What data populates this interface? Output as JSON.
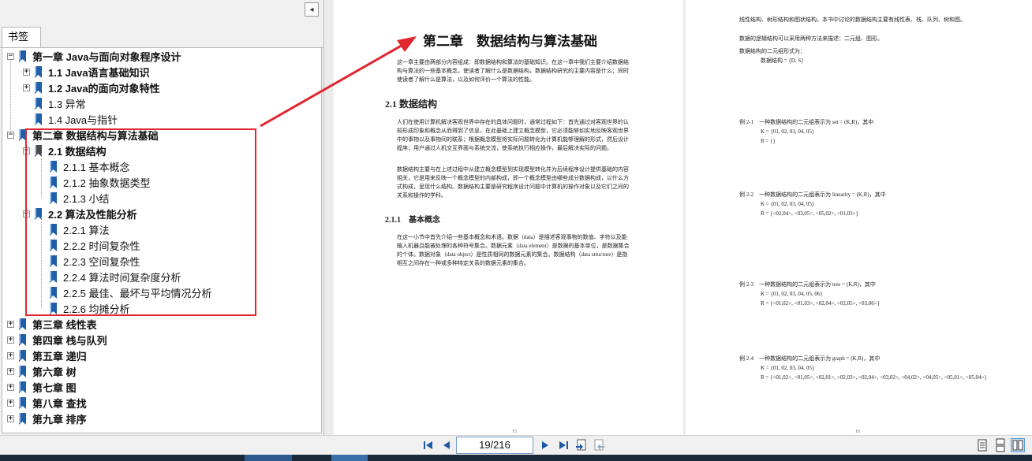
{
  "sidebar": {
    "tab_label": "书签",
    "collapse_glyph": "◂",
    "items": [
      {
        "label": "第一章 Java与面向对象程序设计",
        "level": 0,
        "bold": true,
        "expander": "−"
      },
      {
        "label": "1.1 Java语言基础知识",
        "level": 1,
        "bold": true,
        "expander": "+"
      },
      {
        "label": "1.2 Java的面向对象特性",
        "level": 1,
        "bold": true,
        "expander": "+"
      },
      {
        "label": "1.3 异常",
        "level": 1,
        "bold": false,
        "expander": ""
      },
      {
        "label": "1.4 Java与指针",
        "level": 1,
        "bold": false,
        "expander": ""
      },
      {
        "label": "第二章 数据结构与算法基础",
        "level": 0,
        "bold": true,
        "expander": "−"
      },
      {
        "label": "2.1 数据结构",
        "level": 1,
        "bold": true,
        "expander": "−"
      },
      {
        "label": "2.1.1 基本概念",
        "level": 2,
        "bold": false,
        "expander": ""
      },
      {
        "label": "2.1.2 抽象数据类型",
        "level": 2,
        "bold": false,
        "expander": ""
      },
      {
        "label": "2.1.3 小结",
        "level": 2,
        "bold": false,
        "expander": ""
      },
      {
        "label": "2.2 算法及性能分析",
        "level": 1,
        "bold": true,
        "expander": "−"
      },
      {
        "label": "2.2.1 算法",
        "level": 2,
        "bold": false,
        "expander": ""
      },
      {
        "label": "2.2.2 时间复杂性",
        "level": 2,
        "bold": false,
        "expander": ""
      },
      {
        "label": "2.2.3 空间复杂性",
        "level": 2,
        "bold": false,
        "expander": ""
      },
      {
        "label": "2.2.4 算法时间复杂度分析",
        "level": 2,
        "bold": false,
        "expander": ""
      },
      {
        "label": "2.2.5 最佳、最坏与平均情况分析",
        "level": 2,
        "bold": false,
        "expander": ""
      },
      {
        "label": "2.2.6 均摊分析",
        "level": 2,
        "bold": false,
        "expander": ""
      },
      {
        "label": "第三章 线性表",
        "level": 0,
        "bold": true,
        "expander": "+"
      },
      {
        "label": "第四章 栈与队列",
        "level": 0,
        "bold": true,
        "expander": "+"
      },
      {
        "label": "第五章 递归",
        "level": 0,
        "bold": true,
        "expander": "+"
      },
      {
        "label": "第六章 树",
        "level": 0,
        "bold": true,
        "expander": "+"
      },
      {
        "label": "第七章 图",
        "level": 0,
        "bold": true,
        "expander": "+"
      },
      {
        "label": "第八章 查找",
        "level": 0,
        "bold": true,
        "expander": "+"
      },
      {
        "label": "第九章 排序",
        "level": 0,
        "bold": true,
        "expander": "+"
      }
    ]
  },
  "page_left": {
    "chapter_title": "第二章　数据结构与算法基础",
    "intro": "这一章主要由两部分内容组成：即数据结构和算法的基础知识。在这一章中我们主要介绍数据结构与算法的一些基本概念，使读者了解什么是数据结构，数据结构研究的主要内容是什么；同时使读者了解什么是算法，以及如何评价一个算法的性能。",
    "section_title": "2.1 数据结构",
    "section_text": "人们在使用计算机解决客观世界中存在的具体问题时，通常过程如下：首先通过对客观世界的认知形成印象和概念从而得到了信息，在此基础上建立概念模型，它必须能够如实地反映客观世界中的事物以及事物间的联系；根据概念模型将实际问题转化为计算机能够理解的形式，然后设计程序；用户通过人机交互界面与系统交流，使系统执行相应操作，最后解决实际的问题。",
    "section_text2": "数据结构主要与在上述过程中从建立概念模型到实现模型转化并为后续程序设计提供基础的内容相关，它是用来反映一个概念模型的内部构成，即一个概念模型由哪些成分数据构成，以什么方式构成，呈现什么结构。数据结构主要是研究程序设计问题中计算机的操作对象以及它们之间的关系和操作的学科。",
    "subsection_title": "2.1.1　基本概念",
    "sub_text": "在这一小节中首先介绍一些基本概念和术语。数据（data）是描述客观事物的数值、字符以及能输入机器且能被处理的各种符号集合。数据元素（data element）是数据的基本单位，是数据集合的个体。数据对象（data object）是性质相同的数据元素的集合。数据结构（data structure）是指相互之间存在一种或多种特定关系的数据元素的集合。",
    "page_number": "15"
  },
  "page_right": {
    "lines": [
      "线性结构、树形结构和图状结构。本书中讨论的数据结构主要有线性表、栈、队列、树和图。",
      "数据的逻辑结构可以采用两种方法来描述：二元组、图形。",
      "数据结构的二元组形式为：",
      "数据结构 = {D, S}",
      "例 2-1　一种数据结构的二元组表示为 set = (K,R)，其中",
      "K = {01, 02, 03, 04, 05}",
      "R = {}",
      "例 2-2　一种数据结构的二元组表示为 linearity = (K,R)，其中",
      "K = {01, 02, 03, 04, 05}",
      "R = {<02,04>, <03,05>, <05,02>, <01,03>}",
      "例 2-3　一种数据结构的二元组表示为 tree = (K,R)，其中",
      "K = {01, 02, 03, 04, 05, 06}",
      "R = {<01,02>, <01,03>, <02,04>, <02,05>, <03,06>}",
      "例 2-4　一种数据结构的二元组表示为 graph = (K,R)，其中",
      "K = {01, 02, 03, 04, 05}",
      "R = {<01,02>, <01,05>, <02,01>, <02,03>, <02,04>, <03,02>, <04,02>, <04,05>, <05,01>, <05,04>}"
    ],
    "page_number": "16"
  },
  "toolbar": {
    "page_display": "19/216",
    "first_icon": "first-page-icon",
    "prev_icon": "prev-page-icon",
    "next_icon": "next-page-icon",
    "last_icon": "last-page-icon"
  },
  "colors": {
    "highlight": "#e0262e",
    "bookmark": "#1f5fa8",
    "bookmark_selected": "#4a4a4a"
  }
}
